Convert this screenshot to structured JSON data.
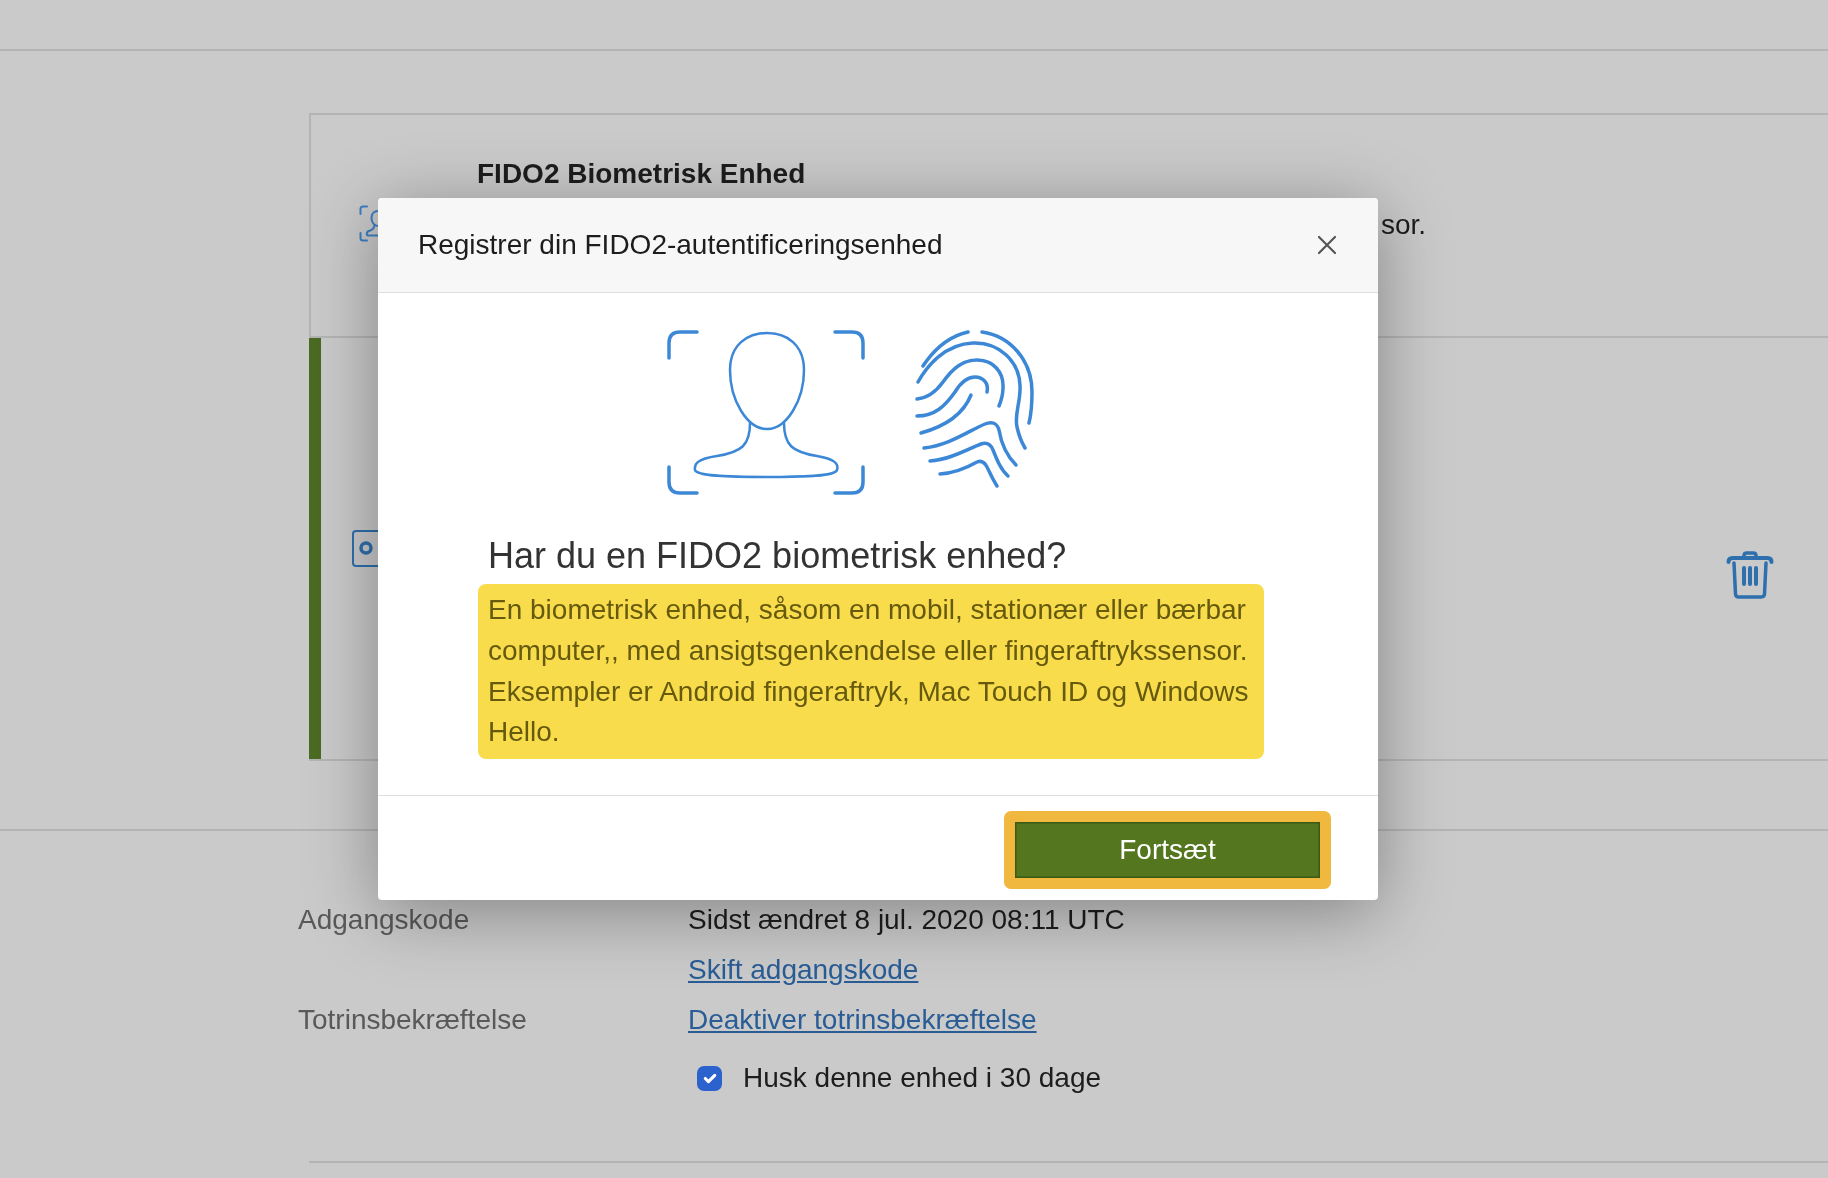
{
  "page": {
    "device_panel": {
      "title": "FIDO2 Biometrisk Enhed",
      "description": "sor."
    },
    "device_row": {
      "highlighted": true
    },
    "settings": [
      {
        "label": "Adgangskode",
        "lines": [
          {
            "kind": "text",
            "text": "Sidst ændret 8 jul. 2020 08:11 UTC"
          },
          {
            "kind": "link",
            "text": "Skift adgangskode"
          }
        ]
      },
      {
        "label": "Totrinsbekræftelse",
        "lines": [
          {
            "kind": "link",
            "text": "Deaktiver totrinsbekræftelse"
          },
          {
            "kind": "checkbox",
            "text": "Husk denne enhed i 30 dage",
            "checked": true
          }
        ]
      }
    ]
  },
  "modal": {
    "title": "Registrer din FIDO2-autentificeringsenhed",
    "heading": "Har du en FIDO2 biometrisk enhed?",
    "message": "En biometrisk enhed, såsom en mobil, stationær eller bærbar computer,, med ansigtsgenkendelse eller fingeraftrykssensor. Eksempler er Android fingeraftryk, Mac Touch ID og Windows Hello.",
    "button": {
      "label": "Fortsæt",
      "focused": true
    }
  }
}
